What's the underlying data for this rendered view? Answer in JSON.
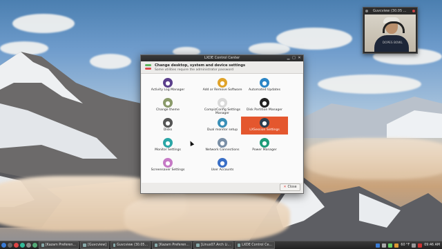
{
  "webcam": {
    "title": "Guvcview (30.05 ...",
    "shirt_text": "DOPES BOWL"
  },
  "dialog": {
    "title": "LXDE Control Center",
    "banner_title": "Change desktop, system and device settings",
    "banner_subtitle": "Some utilities require the administrator password",
    "close_label": "Close",
    "items": [
      {
        "label": "Activity Log Manager",
        "icon": "eye-icon",
        "color": "#5b3f8c"
      },
      {
        "label": "Add or Remove Software",
        "icon": "package-icon",
        "color": "#e0a32a"
      },
      {
        "label": "Automated Updates",
        "icon": "update-icon",
        "color": "#2c86c6"
      },
      {
        "label": "Change theme",
        "icon": "theme-icon",
        "color": "#8a9a6a"
      },
      {
        "label": "CompizConfig Settings Manager",
        "icon": "compiz-icon",
        "color": "#d9d9d9"
      },
      {
        "label": "Disk Partition Manager",
        "icon": "disk-partition-icon",
        "color": "#222222"
      },
      {
        "label": "Disks",
        "icon": "disks-icon",
        "color": "#555555"
      },
      {
        "label": "Dual monitor setup",
        "icon": "monitor-icon",
        "color": "#3a8fb7"
      },
      {
        "label": "LXSession Settings",
        "icon": "session-icon",
        "color": "#2c3e50"
      },
      {
        "label": "Monitor Settings",
        "icon": "display-icon",
        "color": "#2aa6a6"
      },
      {
        "label": "Network Connections",
        "icon": "network-icon",
        "color": "#7a8fa6"
      },
      {
        "label": "Power Manager",
        "icon": "power-icon",
        "color": "#1f9c7a"
      },
      {
        "label": "Screensaver Settings",
        "icon": "screensaver-icon",
        "color": "#c67ac6"
      },
      {
        "label": "User Accounts",
        "icon": "user-icon",
        "color": "#3a6fc6"
      }
    ],
    "selected_index": 8
  },
  "taskbar": {
    "tasks": [
      {
        "label": "[Kazam Preferen..."
      },
      {
        "label": "[Guvcview]"
      },
      {
        "label": "Guvcview (30.05..."
      },
      {
        "label": "[Kazam Preferen..."
      },
      {
        "label": "[Linux07.Arch Li..."
      },
      {
        "label": "LXDE Control Ce..."
      }
    ],
    "clock": "09:46 AM",
    "volume": "60 °F"
  },
  "colors": {
    "accent": "#e4572e",
    "titlebar": "#2f2f2f"
  }
}
